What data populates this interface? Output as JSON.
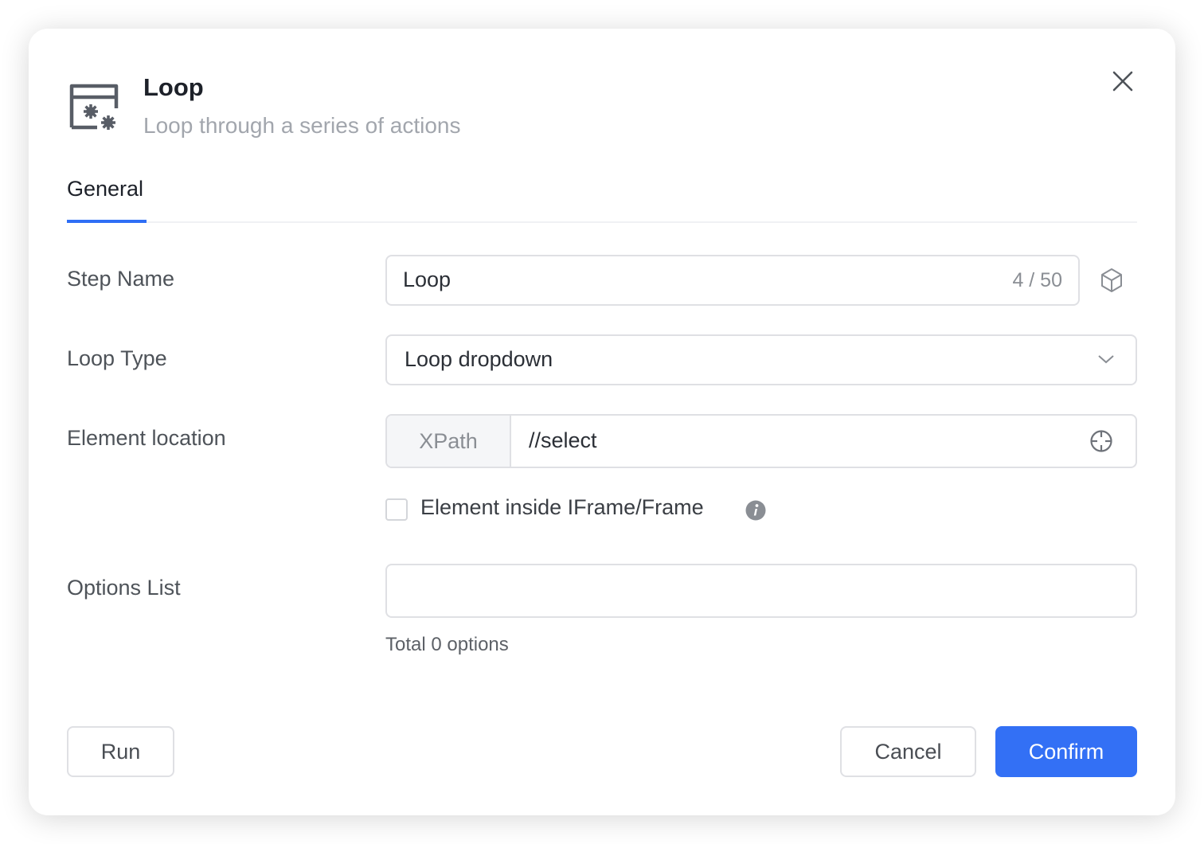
{
  "dialog": {
    "icon": "window-gears-icon",
    "title": "Loop",
    "subtitle": "Loop through a series of actions",
    "close_icon": "close-icon"
  },
  "tabs": [
    {
      "label": "General",
      "active": true
    }
  ],
  "colors": {
    "accent": "#3370f5",
    "title": "#1d2129",
    "label": "#4e5359",
    "border": "#dfe0e4",
    "subtitle": "#a2a6ad"
  },
  "form": {
    "step_name": {
      "label": "Step Name",
      "value": "Loop",
      "counter": "4 / 50",
      "side_icon": "cube-icon"
    },
    "loop_type": {
      "label": "Loop Type",
      "value": "Loop dropdown",
      "icon": "chevron-down-icon"
    },
    "element_location": {
      "label": "Element location",
      "addon": "XPath",
      "value": "//select",
      "icon": "crosshair-icon"
    },
    "iframe": {
      "label": "Element inside IFrame/Frame",
      "checked": false,
      "icon": "info-icon"
    },
    "options_list": {
      "label": "Options List",
      "value": "",
      "helper": "Total 0 options"
    }
  },
  "footer": {
    "run_label": "Run",
    "cancel_label": "Cancel",
    "confirm_label": "Confirm"
  }
}
